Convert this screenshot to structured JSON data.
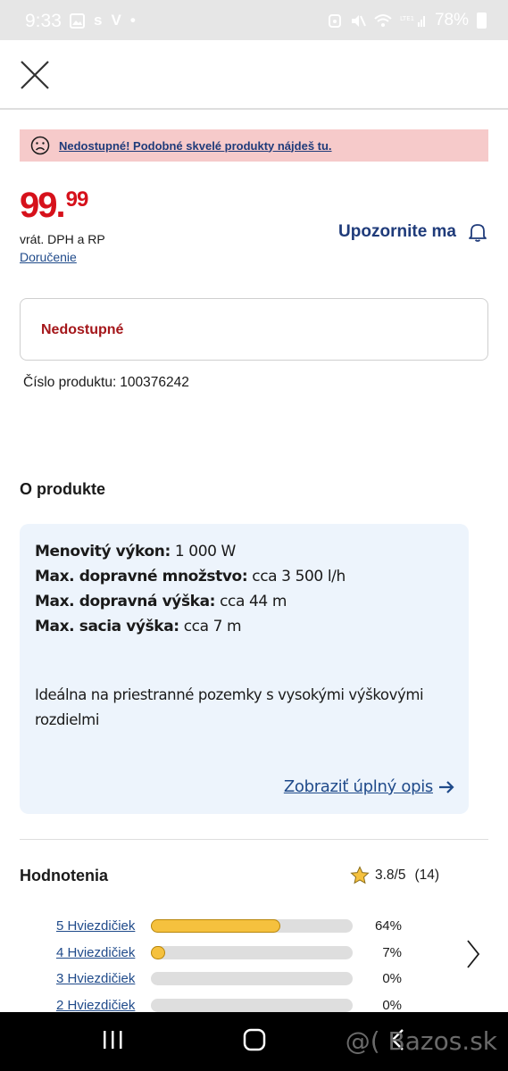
{
  "status_bar": {
    "time": "9:33",
    "battery": "78%",
    "left_glyphs": [
      "s",
      "V",
      "•"
    ]
  },
  "alert": {
    "message": "Nedostupné! Podobné skvelé produkty nájdeš tu."
  },
  "price": {
    "integer": "99",
    "separator": ".",
    "cents": "99",
    "vat_note": "vrát. DPH a RP",
    "delivery_link": "Doručenie"
  },
  "notify": {
    "label": "Upozornite ma"
  },
  "availability": {
    "status": "Nedostupné"
  },
  "product_number": {
    "label": "Číslo produktu:",
    "value": "100376242"
  },
  "about": {
    "title": "O produkte",
    "specs": [
      {
        "name": "Menovitý výkon:",
        "value": "1 000 W"
      },
      {
        "name": "Max. dopravné množstvo:",
        "value": "cca 3 500 l/h"
      },
      {
        "name": "Max. dopravná výška:",
        "value": "cca 44 m"
      },
      {
        "name": "Max. sacia výška:",
        "value": "cca 7 m"
      }
    ],
    "paragraph": "Ideálna na priestranné pozemky s vysokými výškovými rozdielmi",
    "more_link": "Zobraziť úplný opis"
  },
  "ratings": {
    "title": "Hodnotenia",
    "average": "3.8/5",
    "count": "(14)",
    "rows": [
      {
        "label": "5 Hviezdičiek",
        "percent": "64%",
        "fraction": 0.64
      },
      {
        "label": "4 Hviezdičiek",
        "percent": "7%",
        "fraction": 0.07
      },
      {
        "label": "3 Hviezdičiek",
        "percent": "0%",
        "fraction": 0.0
      },
      {
        "label": "2 Hviezdičiek",
        "percent": "0%",
        "fraction": 0.0
      }
    ]
  },
  "watermark": "@( Bazos.sk",
  "colors": {
    "price_red": "#d6111b",
    "link_blue": "#1f4a8a",
    "alert_bg": "#f6caca",
    "card_bg": "#edf4fc",
    "star_yellow": "#f5c13e"
  },
  "icons": [
    "close-icon",
    "sad-face-icon",
    "bell-icon",
    "arrow-right-icon",
    "star-icon",
    "chevron-right-icon",
    "recents-icon",
    "home-icon",
    "back-icon"
  ]
}
